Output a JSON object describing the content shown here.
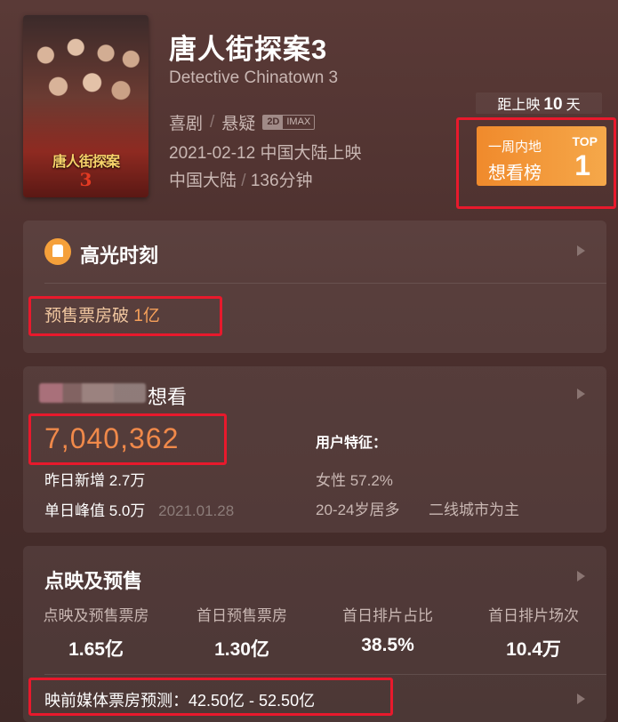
{
  "movie": {
    "poster_title": "唐人街探案",
    "poster_number": "3",
    "title": "唐人街探案3",
    "english_title": "Detective Chinatown 3",
    "genres": [
      "喜剧",
      "悬疑"
    ],
    "format_badge": [
      "2D",
      "IMAX"
    ],
    "release_line": "2021-02-12 中国大陆上映",
    "region": "中国大陆",
    "duration": "136分钟"
  },
  "countdown": {
    "prefix": "距上映",
    "days": "10",
    "suffix": "天"
  },
  "rank_card": {
    "line1": "一周内地",
    "line2": "想看榜",
    "top_label": "TOP",
    "rank": "1"
  },
  "highlights": {
    "title": "高光时刻",
    "item_text": "预售票房破",
    "item_value": "1亿"
  },
  "want_to_see": {
    "label": "想看",
    "count": "7,040,362",
    "yesterday_label": "昨日新增",
    "yesterday_value": "2.7万",
    "peak_label": "单日峰值",
    "peak_value": "5.0万",
    "peak_date": "2021.01.28",
    "features_title": "用户特征：",
    "gender": "女性 57.2%",
    "age": "20-24岁居多",
    "city": "二线城市为主"
  },
  "presale": {
    "title": "点映及预售",
    "stats": [
      {
        "label": "点映及预售票房",
        "value": "1.65亿"
      },
      {
        "label": "首日预售票房",
        "value": "1.30亿"
      },
      {
        "label": "首日排片占比",
        "value": "38.5%"
      },
      {
        "label": "首日排片场次",
        "value": "10.4万"
      }
    ],
    "forecast": "映前媒体票房预测：42.50亿 - 52.50亿"
  },
  "colors": {
    "accent_orange": "#f08a2c",
    "highlight_red": "#e8192c",
    "count_orange": "#f0894a"
  }
}
